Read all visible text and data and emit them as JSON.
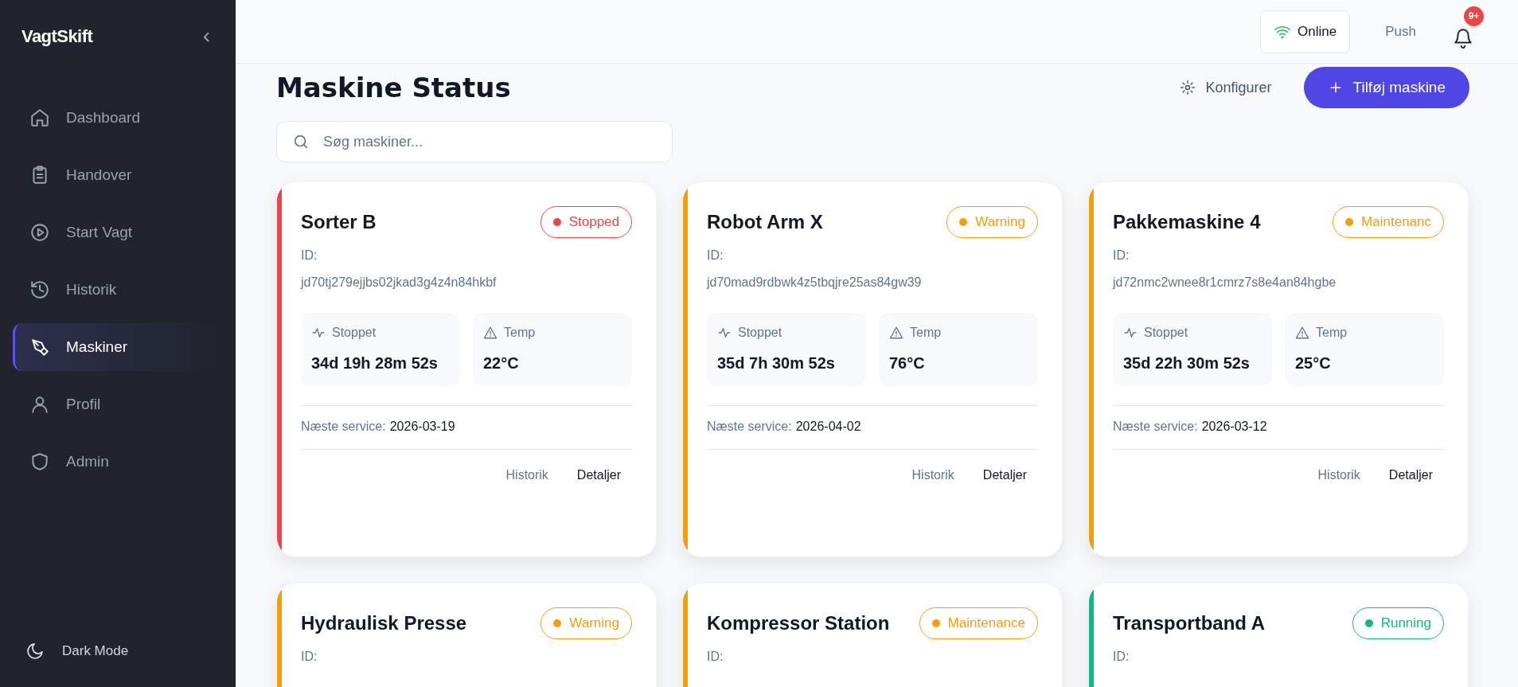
{
  "sidebar": {
    "logo": "VagtSkift",
    "collapse_icon": "‹",
    "items": [
      {
        "label": "Dashboard",
        "selected": false
      },
      {
        "label": "Handover",
        "selected": false
      },
      {
        "label": "Start Vagt",
        "selected": false
      },
      {
        "label": "Historik",
        "selected": false
      },
      {
        "label": "Maskiner",
        "selected": true
      },
      {
        "label": "Profil",
        "selected": false
      },
      {
        "label": "Admin",
        "selected": false
      }
    ],
    "dark_mode": "Dark Mode"
  },
  "header": {
    "connection": "Online",
    "push": "Push",
    "notifications": "9+"
  },
  "page": {
    "title": "Maskine Status",
    "configure": "Konfigurer",
    "add": "Tilføj maskine",
    "search": {
      "placeholder": "Søg maskiner..."
    }
  },
  "machines": [
    {
      "name": "Sorter B",
      "status": "Stopped",
      "color": "#ef4444",
      "id_label": "ID:",
      "id": "jd70tj279ejjbs02jkad3g4z4n84hkbf",
      "stat_1_label": "Stoppet",
      "stat_1": "34d 19h 28m 52s",
      "stat_2_label": "Temp",
      "stat_2": "22°C",
      "service_label": "Næste service:",
      "service": "2026-03-19",
      "history": "Historik",
      "details": "Detaljer"
    },
    {
      "name": "Robot Arm X",
      "status": "Warning",
      "color": "#f59e0b",
      "id_label": "ID:",
      "id": "jd70mad9rdbwk4z5tbqjre25as84gw39",
      "stat_1_label": "Stoppet",
      "stat_1": "35d 7h 30m 52s",
      "stat_2_label": "Temp",
      "stat_2": "76°C",
      "service_label": "Næste service:",
      "service": "2026-04-02",
      "history": "Historik",
      "details": "Detaljer"
    },
    {
      "name": "Pakkemaskine 4",
      "status": "Maintenanc",
      "color": "#f59e0b",
      "id_label": "ID:",
      "id": "jd72nmc2wnee8r1cmrz7s8e4an84hgbe",
      "stat_1_label": "Stoppet",
      "stat_1": "35d 22h 30m 52s",
      "stat_2_label": "Temp",
      "stat_2": "25°C",
      "service_label": "Næste service:",
      "service": "2026-03-12",
      "history": "Historik",
      "details": "Detaljer"
    },
    {
      "name": "Hydraulisk Presse",
      "status": "Warning",
      "color": "#f59e0b",
      "id_label": "ID:"
    },
    {
      "name": "Kompressor Station",
      "status": "Maintenance",
      "color": "#f59e0b",
      "id_label": "ID:"
    },
    {
      "name": "Transportband A",
      "status": "Running",
      "color": "#10b981",
      "id_label": "ID:"
    }
  ]
}
